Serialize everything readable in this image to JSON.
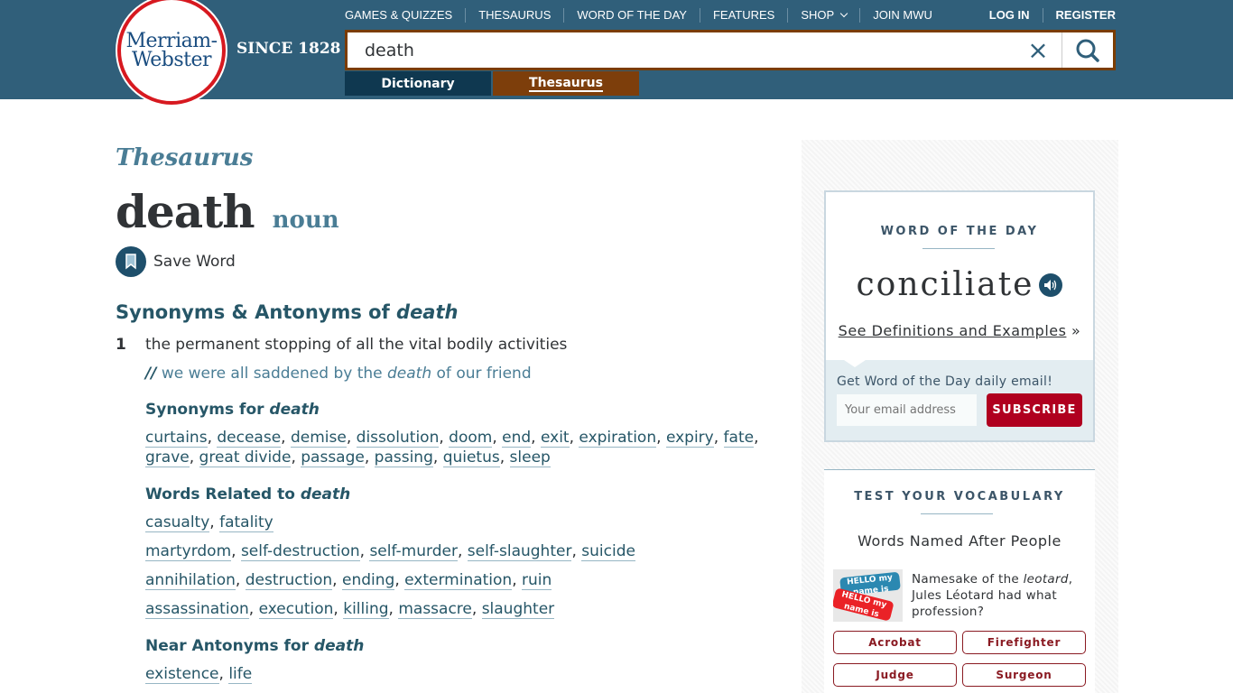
{
  "header": {
    "logo_line1": "Merriam-",
    "logo_line2": "Webster",
    "since": "SINCE 1828",
    "nav": [
      "GAMES & QUIZZES",
      "THESAURUS",
      "WORD OF THE DAY",
      "FEATURES",
      "SHOP",
      "JOIN MWU"
    ],
    "auth": {
      "login": "LOG IN",
      "register": "REGISTER"
    },
    "search": {
      "value": "death",
      "clear_icon": "×"
    },
    "tabs": {
      "dictionary": "Dictionary",
      "thesaurus": "Thesaurus"
    }
  },
  "entry": {
    "section_label": "Thesaurus",
    "headword": "death",
    "part_of_speech": "noun",
    "save_label": "Save Word",
    "syn_title_prefix": "Synonyms & Antonyms of ",
    "syn_title_word": "death",
    "sense": {
      "number": "1",
      "definition": "the permanent stopping of all the vital bodily activities",
      "example_prefix": "we were all saddened by the ",
      "example_word": "death",
      "example_suffix": " of our friend",
      "example_marker": "//"
    },
    "synonyms": {
      "label_prefix": "Synonyms for ",
      "label_word": "death",
      "words": [
        "curtains",
        "decease",
        "demise",
        "dissolution",
        "doom",
        "end",
        "exit",
        "expiration",
        "expiry",
        "fate",
        "grave",
        "great divide",
        "passage",
        "passing",
        "quietus",
        "sleep"
      ]
    },
    "related": {
      "label_prefix": "Words Related to ",
      "label_word": "death",
      "groups": [
        [
          "casualty",
          "fatality"
        ],
        [
          "martyrdom",
          "self-destruction",
          "self-murder",
          "self-slaughter",
          "suicide"
        ],
        [
          "annihilation",
          "destruction",
          "ending",
          "extermination",
          "ruin"
        ],
        [
          "assassination",
          "execution",
          "killing",
          "massacre",
          "slaughter"
        ]
      ]
    },
    "near_antonyms": {
      "label_prefix": "Near Antonyms for ",
      "label_word": "death",
      "words": [
        "existence",
        "life"
      ]
    }
  },
  "sidebar": {
    "wotd": {
      "kicker": "WORD OF THE DAY",
      "word": "conciliate",
      "see_link": "See Definitions and Examples",
      "see_suffix": " »",
      "email_label": "Get Word of the Day daily email!",
      "email_placeholder": "Your email address",
      "subscribe": "SUBSCRIBE"
    },
    "quiz": {
      "kicker": "TEST YOUR VOCABULARY",
      "title": "Words Named After People",
      "img_tag1": "HELLO my name is",
      "img_tag2": "HELLO my name is",
      "question_prefix": "Namesake of the ",
      "question_word": "leotard",
      "question_suffix": ", Jules Léotard had what profession?",
      "answers": [
        "Acrobat",
        "Firefighter",
        "Judge",
        "Surgeon"
      ]
    }
  },
  "colors": {
    "header_bg": "#305f7a",
    "search_border": "#7b3c00",
    "tab_dictionary": "#0f3850",
    "tab_thesaurus": "#7d3e0b",
    "heading": "#265667",
    "accent": "#4a7d95",
    "subscribe": "#b0001f",
    "logo_ring": "#d71920"
  }
}
